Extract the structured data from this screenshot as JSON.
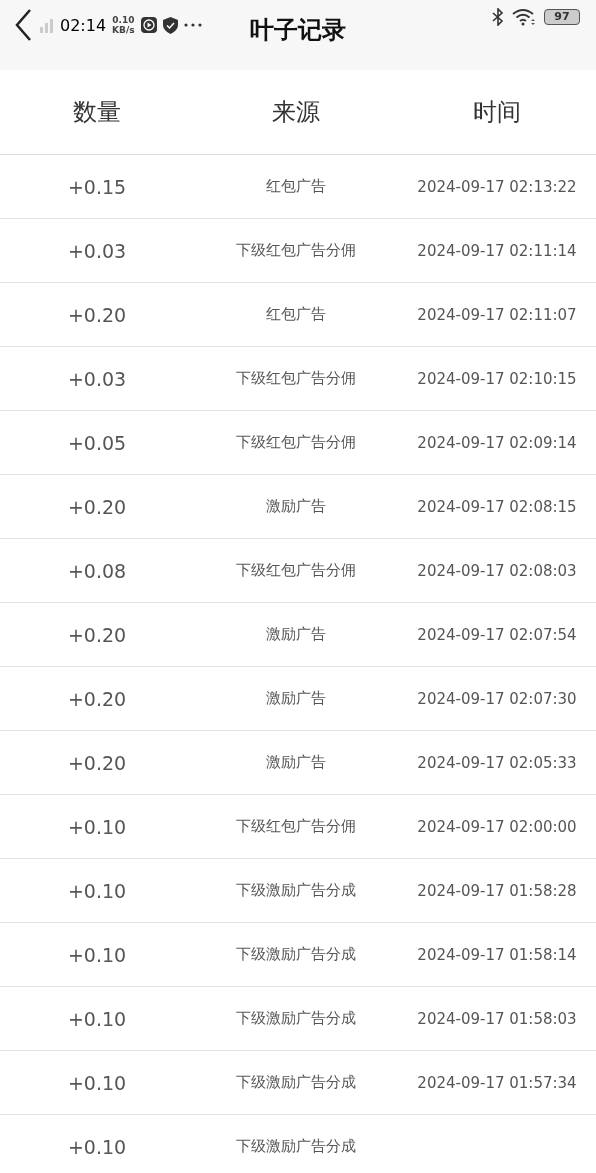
{
  "status_bar": {
    "time": "02:14",
    "speed": "0.10",
    "speed_unit": "KB/s",
    "battery": "97"
  },
  "window": {
    "title": "叶子记录"
  },
  "table": {
    "columns": [
      "数量",
      "来源",
      "时间"
    ],
    "rows": [
      {
        "amount": "+0.15",
        "source": "红包广告",
        "time": "2024-09-17 02:13:22"
      },
      {
        "amount": "+0.03",
        "source": "下级红包广告分佣",
        "time": "2024-09-17 02:11:14"
      },
      {
        "amount": "+0.20",
        "source": "红包广告",
        "time": "2024-09-17 02:11:07"
      },
      {
        "amount": "+0.03",
        "source": "下级红包广告分佣",
        "time": "2024-09-17 02:10:15"
      },
      {
        "amount": "+0.05",
        "source": "下级红包广告分佣",
        "time": "2024-09-17 02:09:14"
      },
      {
        "amount": "+0.20",
        "source": "激励广告",
        "time": "2024-09-17 02:08:15"
      },
      {
        "amount": "+0.08",
        "source": "下级红包广告分佣",
        "time": "2024-09-17 02:08:03"
      },
      {
        "amount": "+0.20",
        "source": "激励广告",
        "time": "2024-09-17 02:07:54"
      },
      {
        "amount": "+0.20",
        "source": "激励广告",
        "time": "2024-09-17 02:07:30"
      },
      {
        "amount": "+0.20",
        "source": "激励广告",
        "time": "2024-09-17 02:05:33"
      },
      {
        "amount": "+0.10",
        "source": "下级红包广告分佣",
        "time": "2024-09-17 02:00:00"
      },
      {
        "amount": "+0.10",
        "source": "下级激励广告分成",
        "time": "2024-09-17 01:58:28"
      },
      {
        "amount": "+0.10",
        "source": "下级激励广告分成",
        "time": "2024-09-17 01:58:14"
      },
      {
        "amount": "+0.10",
        "source": "下级激励广告分成",
        "time": "2024-09-17 01:58:03"
      },
      {
        "amount": "+0.10",
        "source": "下级激励广告分成",
        "time": "2024-09-17 01:57:34"
      },
      {
        "amount": "+0.10",
        "source": "下级激励广告分成"
      }
    ]
  }
}
